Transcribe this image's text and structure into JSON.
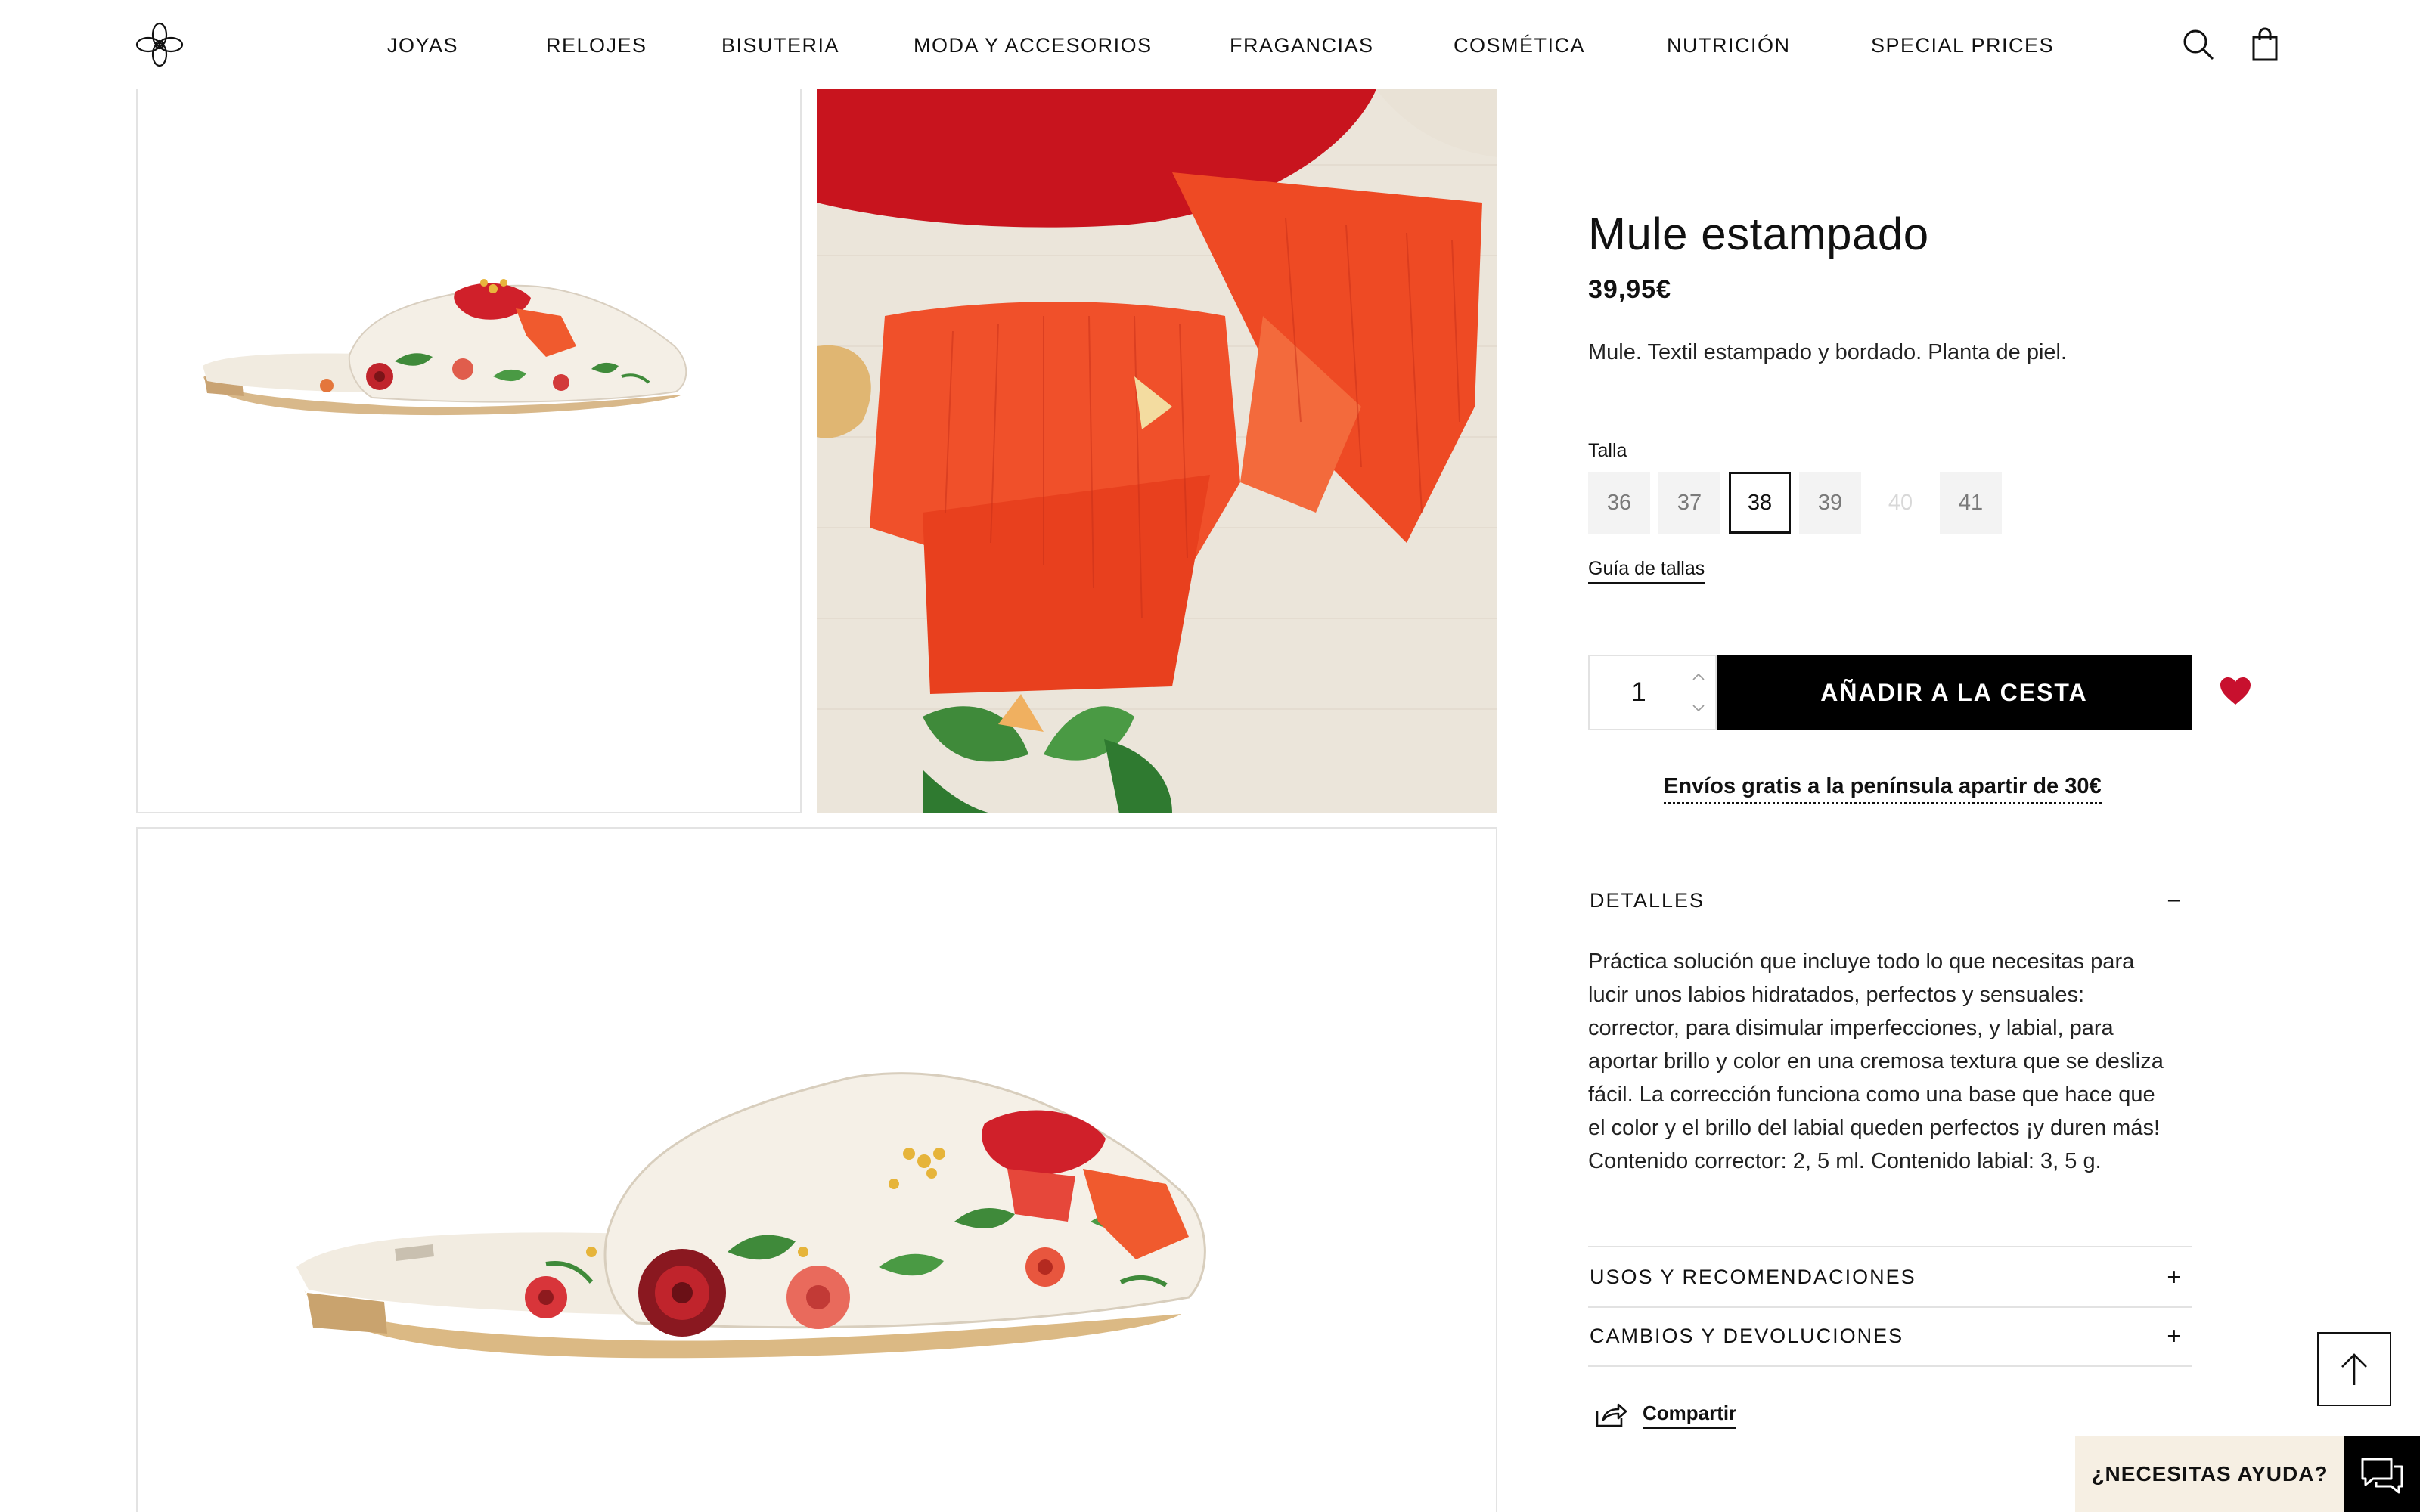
{
  "nav": {
    "items": [
      "JOYAS",
      "RELOJES",
      "BISUTERIA",
      "MODA Y ACCESORIOS",
      "FRAGANCIAS",
      "COSMÉTICA",
      "NUTRICIÓN",
      "SPECIAL PRICES"
    ]
  },
  "header": {
    "logo_icon": "flower-logo-icon",
    "search_icon": "search-icon",
    "cart_icon": "shopping-bag-icon"
  },
  "product": {
    "title": "Mule estampado",
    "price": "39,95€",
    "short_description": "Mule. Textil estampado y bordado. Planta de piel.",
    "size_label": "Talla",
    "sizes": [
      "36",
      "37",
      "38",
      "39",
      "40",
      "41"
    ],
    "selected_size": "38",
    "unavailable_sizes": [
      "40"
    ],
    "size_guide": "Guía de tallas",
    "quantity": "1",
    "add_to_cart": "AÑADIR A LA CESTA",
    "shipping_note": "Envíos gratis a la península apartir de 30€"
  },
  "accordion": {
    "details_title": "DETALLES",
    "details_sign": "−",
    "details_body": "Práctica solución que incluye todo lo que necesitas para lucir unos labios hidratados, perfectos y sensuales: corrector, para disimular imperfecciones, y labial, para aportar brillo y color en una cremosa textura que se desliza fácil. La corrección funciona como una base que hace que el color y el brillo del labial queden perfectos ¡y duren más! Contenido corrector: 2, 5 ml. Contenido labial: 3, 5 g.",
    "uses_title": "USOS Y RECOMENDACIONES",
    "returns_title": "CAMBIOS Y DEVOLUCIONES",
    "collapsed_sign": "+"
  },
  "share": {
    "label": "Compartir"
  },
  "help": {
    "label": "¿NECESITAS AYUDA?"
  },
  "colors": {
    "accent": "#000000",
    "heart": "#c8102e",
    "help_bg": "#f6efe3"
  }
}
